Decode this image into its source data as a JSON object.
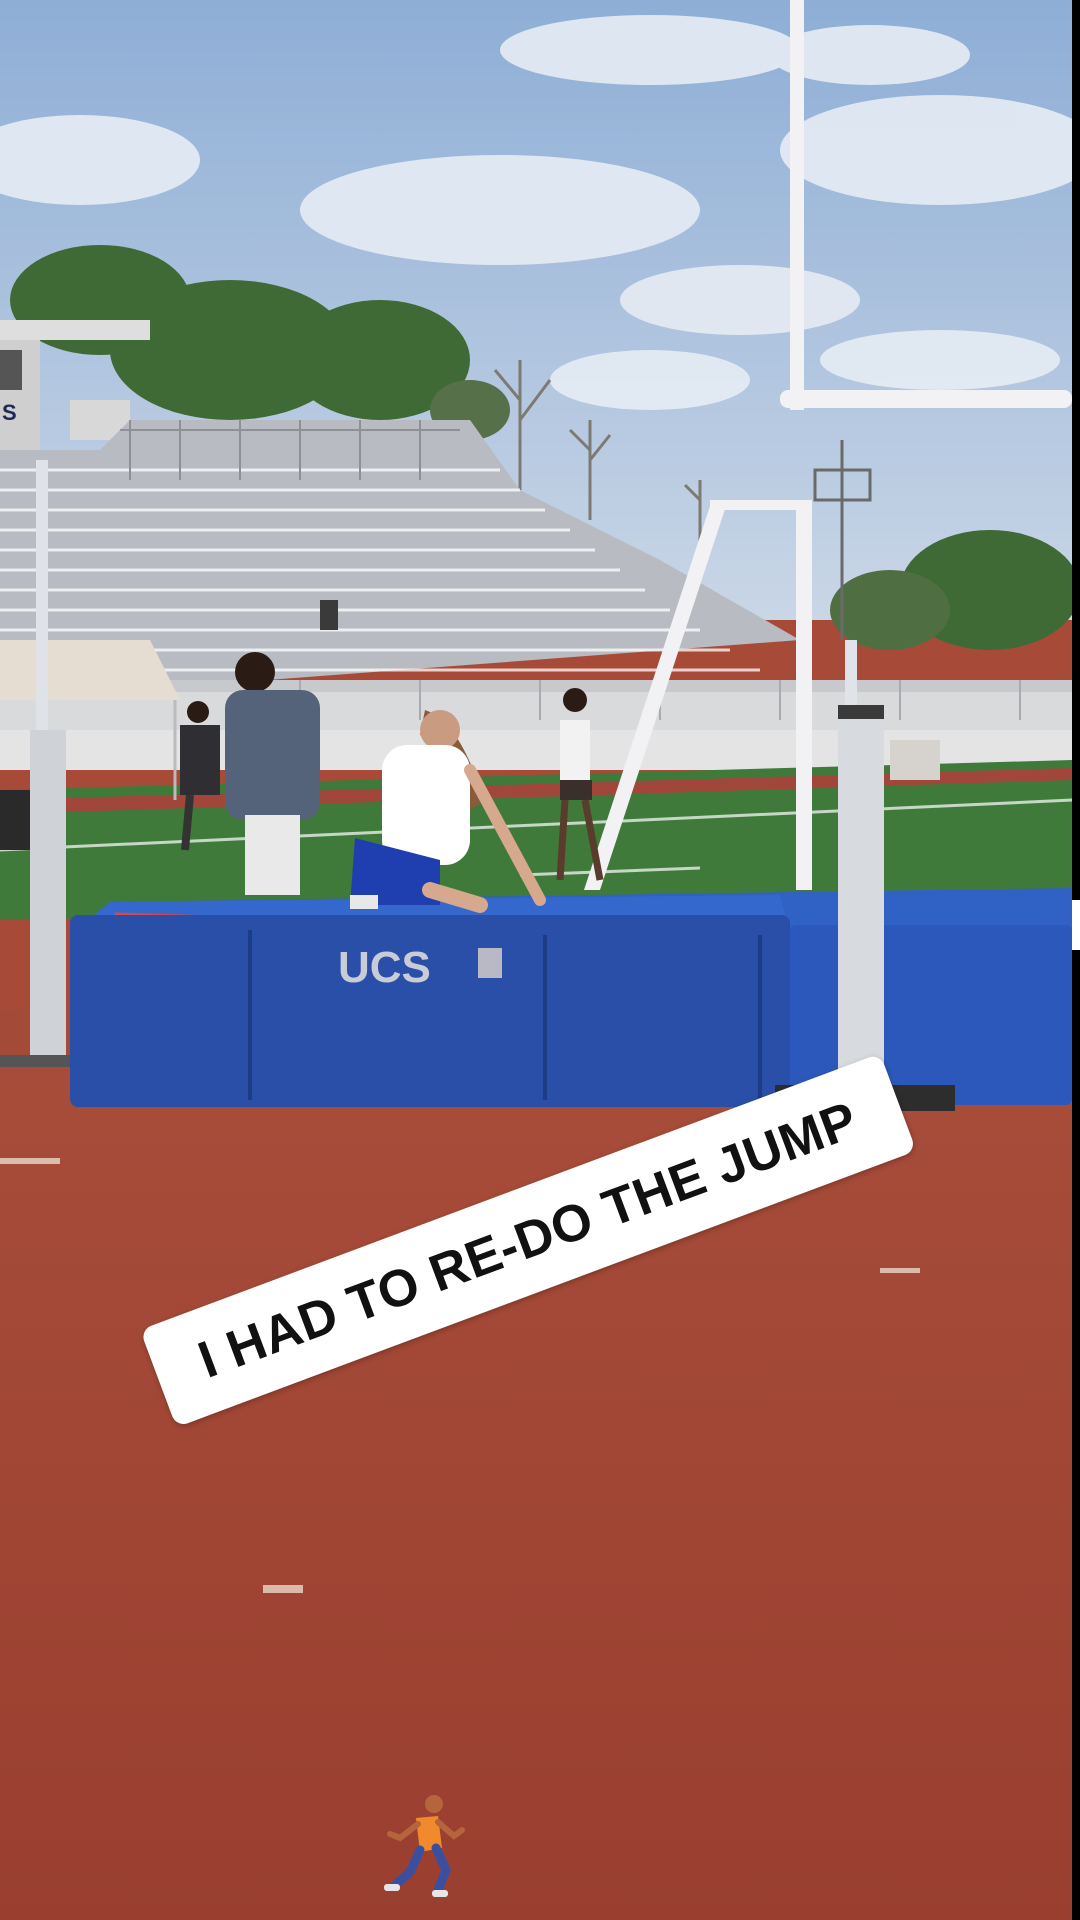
{
  "caption": {
    "text": "I HAD TO RE-DO THE JUMP"
  },
  "mat": {
    "brand_text": "UCS"
  },
  "press_box": {
    "sign_text": "S"
  },
  "sticker": {
    "icon": "running-person-icon"
  },
  "colors": {
    "sky": "#9fb9d8",
    "track": "#a84a38",
    "mat_blue": "#2a4fa8",
    "caption_bg": "#ffffff",
    "caption_text": "#111111"
  }
}
